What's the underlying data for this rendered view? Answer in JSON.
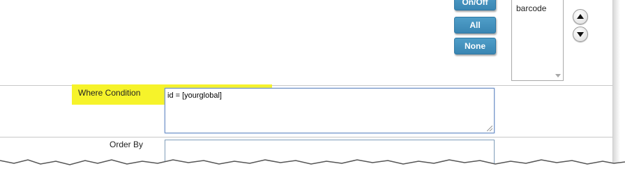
{
  "column_buttons": {
    "on_off_label": "On/Off",
    "all_label": "All",
    "none_label": "None"
  },
  "field_list": {
    "items": [
      "barcode"
    ]
  },
  "where_condition": {
    "label": "Where Condition",
    "value": "id = [yourglobal]",
    "highlight_color": "#f6f32a"
  },
  "order_by": {
    "label": "Order By",
    "value": ""
  },
  "colors": {
    "button": "#3f8fbd"
  }
}
